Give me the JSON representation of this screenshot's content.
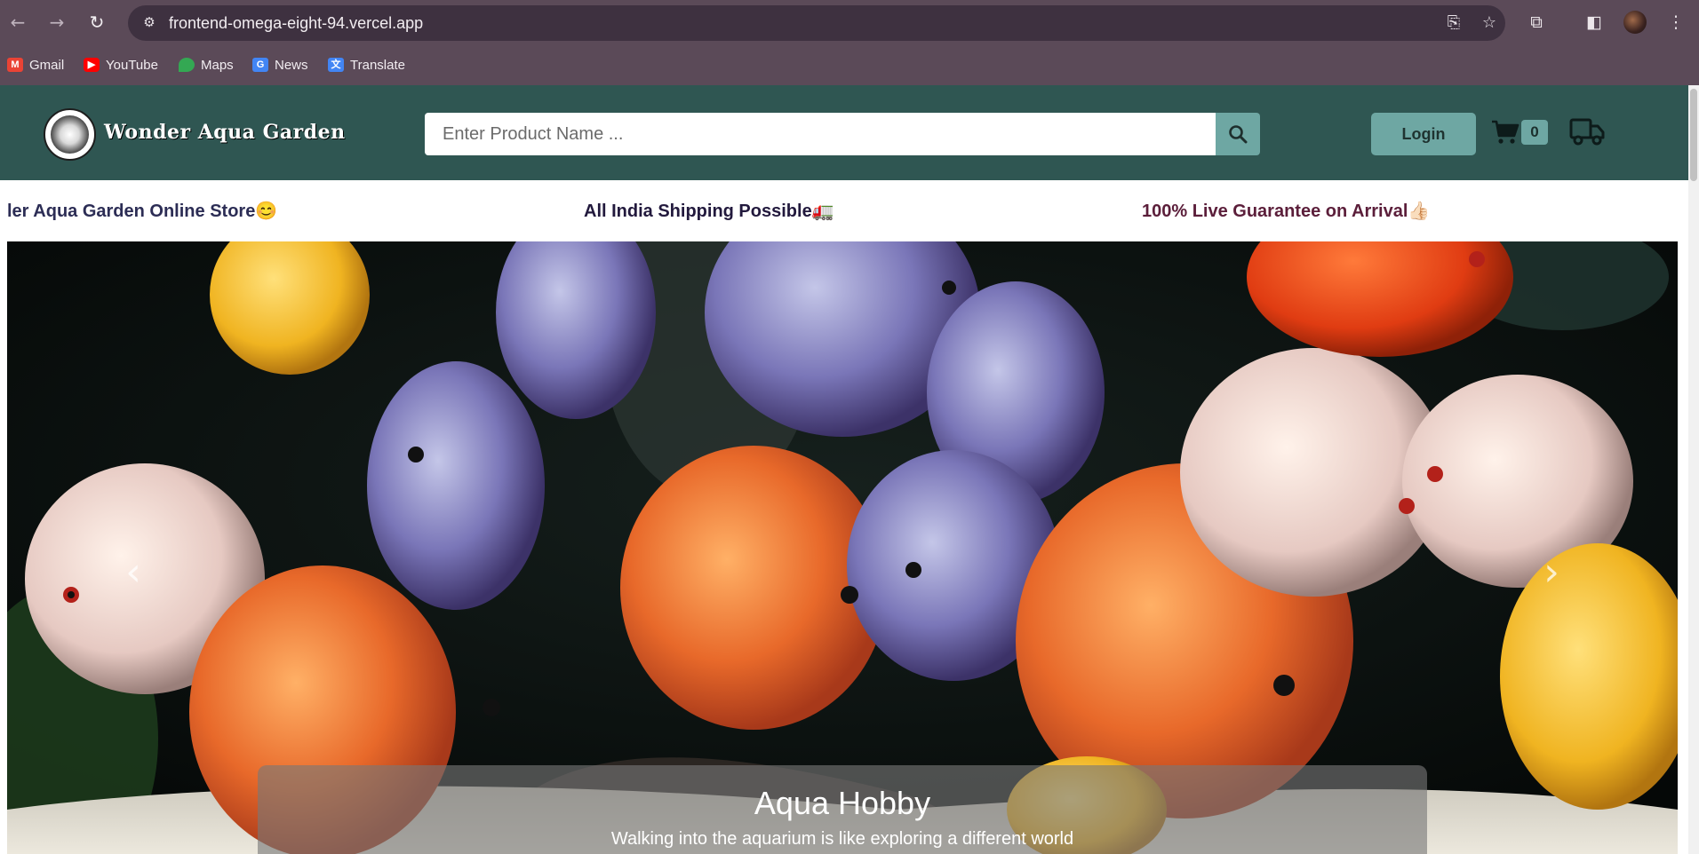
{
  "browser": {
    "url": "frontend-omega-eight-94.vercel.app",
    "bookmarks": [
      {
        "label": "Gmail",
        "icon": "gmail-icon",
        "color": "#ea4335"
      },
      {
        "label": "YouTube",
        "icon": "youtube-icon",
        "color": "#ff0000"
      },
      {
        "label": "Maps",
        "icon": "maps-icon",
        "color": "#34a853"
      },
      {
        "label": "News",
        "icon": "news-icon",
        "color": "#4285f4"
      },
      {
        "label": "Translate",
        "icon": "translate-icon",
        "color": "#4285f4"
      }
    ]
  },
  "header": {
    "brand": "Wonder Aqua Garden",
    "search_placeholder": "Enter Product Name ...",
    "login_label": "Login",
    "cart_count": "0",
    "colors": {
      "header_bg": "#2f5652",
      "accent": "#6ea7a3"
    }
  },
  "marquee": {
    "items": [
      "ler Aqua Garden Online Store😊",
      "All India Shipping Possible🚛",
      "100% Live Guarantee on Arrival👍🏻"
    ]
  },
  "hero": {
    "title": "Aqua Hobby",
    "subtitle": "Walking into the aquarium is like exploring a different world",
    "prev_arrow": "‹",
    "next_arrow": "›"
  }
}
